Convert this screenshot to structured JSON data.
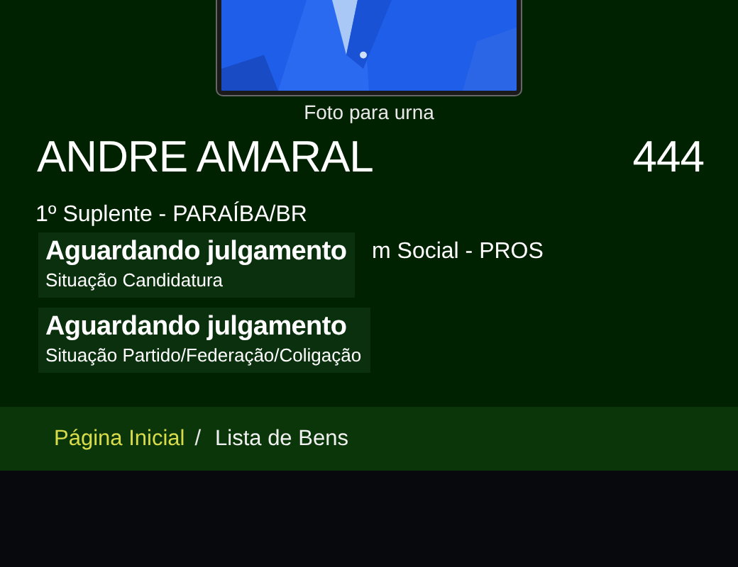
{
  "photo": {
    "kind": "picture",
    "caption": "Foto para urna"
  },
  "candidate": {
    "name": "ANDRE AMARAL",
    "number": "444",
    "office": "1º Suplente - PARAÍBA/BR",
    "party": "m Social - PROS"
  },
  "statuses": [
    {
      "value": "Aguardando julgamento",
      "label": "Situação Candidatura"
    },
    {
      "value": "Aguardando julgamento",
      "label": "Situação Partido/Federação/Coligação"
    }
  ],
  "breadcrumb": [
    {
      "label": "Página Inicial",
      "kind": "link",
      "separator": "/"
    },
    {
      "label": "Lista de Bens",
      "kind": "current"
    }
  ]
}
